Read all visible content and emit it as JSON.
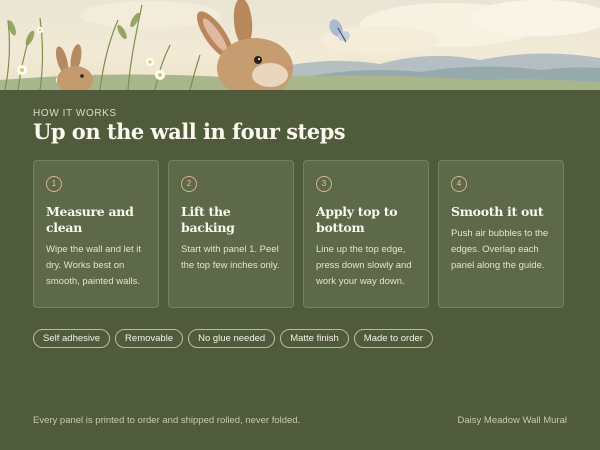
{
  "hero": {
    "illustration_icons": [
      "rabbit-icon",
      "rabbit-icon",
      "butterfly-icon",
      "daisy-icon"
    ]
  },
  "section": {
    "eyebrow": "HOW IT WORKS",
    "heading": "Up on the wall in four steps"
  },
  "steps": [
    {
      "number": "1",
      "title": "Measure and clean",
      "body": "Wipe the wall and let it dry. Works best on smooth, painted walls."
    },
    {
      "number": "2",
      "title": "Lift the backing",
      "body": "Start with panel 1. Peel the top few inches only."
    },
    {
      "number": "3",
      "title": "Apply top to bottom",
      "body": "Line up the top edge, press down slowly and work your way down."
    },
    {
      "number": "4",
      "title": "Smooth it out",
      "body": "Push air bubbles to the edges. Overlap each panel along the guide."
    }
  ],
  "tags": [
    "Self adhesive",
    "Removable",
    "No glue needed",
    "Matte finish",
    "Made to order"
  ],
  "footer": {
    "note": "Every panel is printed to order and shipped rolled, never folded.",
    "brand": "Daisy Meadow Wall Mural"
  },
  "colors": {
    "background": "#4f5b3b",
    "card": "#5d6949",
    "step_ring": "#d9b28a"
  }
}
